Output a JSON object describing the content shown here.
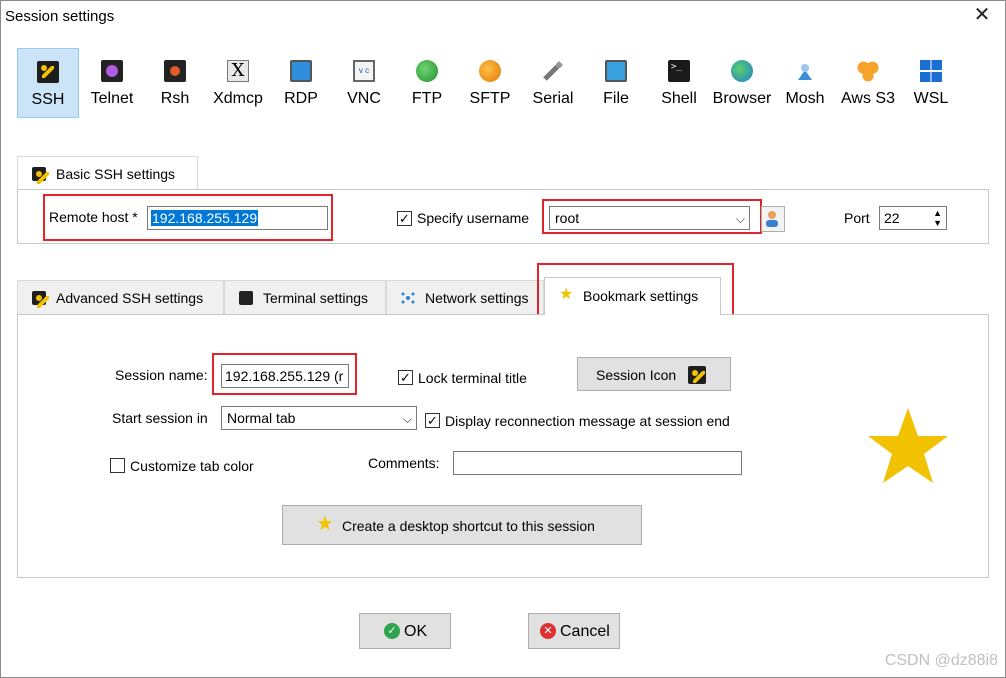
{
  "window": {
    "title": "Session settings",
    "close_icon": "close-icon"
  },
  "protocols": [
    {
      "label": "SSH",
      "icon": "ssh-key-icon",
      "selected": true
    },
    {
      "label": "Telnet",
      "icon": "telnet-icon"
    },
    {
      "label": "Rsh",
      "icon": "rsh-icon"
    },
    {
      "label": "Xdmcp",
      "icon": "xdmcp-icon"
    },
    {
      "label": "RDP",
      "icon": "rdp-icon"
    },
    {
      "label": "VNC",
      "icon": "vnc-icon"
    },
    {
      "label": "FTP",
      "icon": "ftp-icon"
    },
    {
      "label": "SFTP",
      "icon": "sftp-icon"
    },
    {
      "label": "Serial",
      "icon": "serial-icon"
    },
    {
      "label": "File",
      "icon": "file-icon"
    },
    {
      "label": "Shell",
      "icon": "shell-icon"
    },
    {
      "label": "Browser",
      "icon": "browser-icon"
    },
    {
      "label": "Mosh",
      "icon": "mosh-icon"
    },
    {
      "label": "Aws S3",
      "icon": "aws-s3-icon"
    },
    {
      "label": "WSL",
      "icon": "wsl-icon"
    }
  ],
  "basic": {
    "tab_label": "Basic SSH settings",
    "remote_host_label": "Remote host *",
    "remote_host_value": "192.168.255.129",
    "specify_username_label": "Specify username",
    "specify_username_checked": true,
    "username_value": "root",
    "port_label": "Port",
    "port_value": "22"
  },
  "tabs": [
    {
      "label": "Advanced SSH settings",
      "icon": "key-icon"
    },
    {
      "label": "Terminal settings",
      "icon": "terminal-icon"
    },
    {
      "label": "Network settings",
      "icon": "network-icon"
    },
    {
      "label": "Bookmark settings",
      "icon": "star-icon",
      "active": true
    }
  ],
  "bookmark": {
    "session_name_label": "Session name:",
    "session_name_value": "192.168.255.129 (r",
    "lock_title_label": "Lock terminal title",
    "lock_title_checked": true,
    "session_icon_label": "Session Icon",
    "start_session_label": "Start session in",
    "start_session_value": "Normal tab",
    "display_reconnect_label": "Display reconnection message at session end",
    "display_reconnect_checked": true,
    "customize_tab_color_label": "Customize tab color",
    "customize_tab_color_checked": false,
    "comments_label": "Comments:",
    "comments_value": "",
    "shortcut_label": "Create a desktop shortcut to this session"
  },
  "footer": {
    "ok_label": "OK",
    "cancel_label": "Cancel"
  },
  "watermark": "CSDN @dz88i8",
  "colors": {
    "selection": "#0078d7",
    "highlight": "#e0242b",
    "star": "#f2c200",
    "ok": "#2ea44f",
    "cancel": "#e03131"
  }
}
